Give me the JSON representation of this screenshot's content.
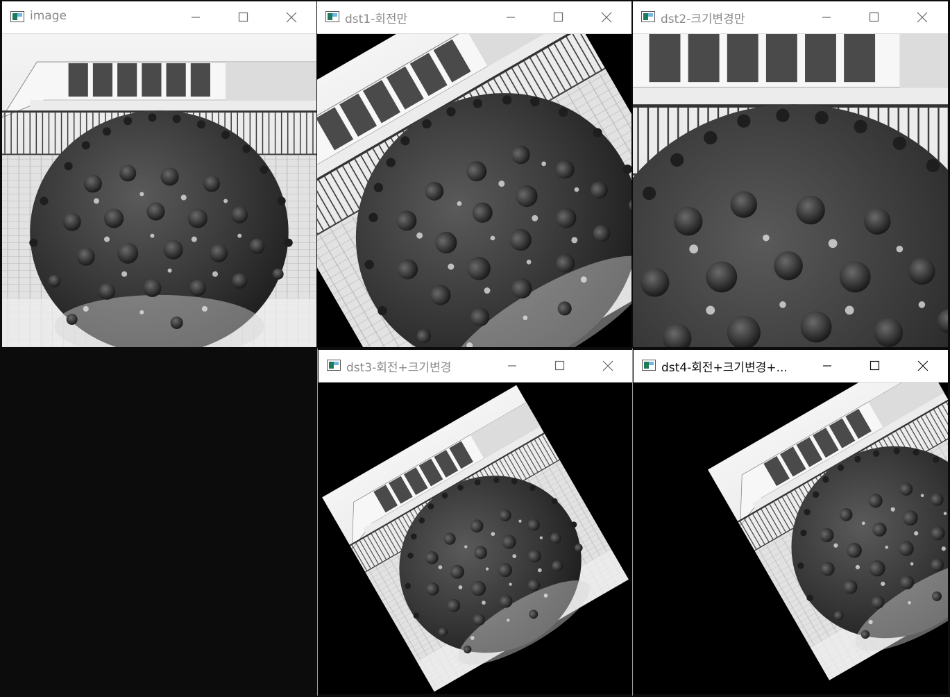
{
  "windows": [
    {
      "id": "image",
      "title": "image"
    },
    {
      "id": "dst1",
      "title": "dst1-회전만"
    },
    {
      "id": "dst2",
      "title": "dst2-크기변경만"
    },
    {
      "id": "dst3",
      "title": "dst3-회전+크기변경"
    },
    {
      "id": "dst4",
      "title": "dst4-회전+크기변경+..."
    }
  ],
  "icons": {
    "app": "opencv-window-icon",
    "minimize": "minimize-icon",
    "maximize": "maximize-icon",
    "close": "close-icon"
  },
  "colors": {
    "desktop": "#0c0c0c",
    "title_inactive": "#8a8a8a",
    "title_active": "#111111"
  }
}
